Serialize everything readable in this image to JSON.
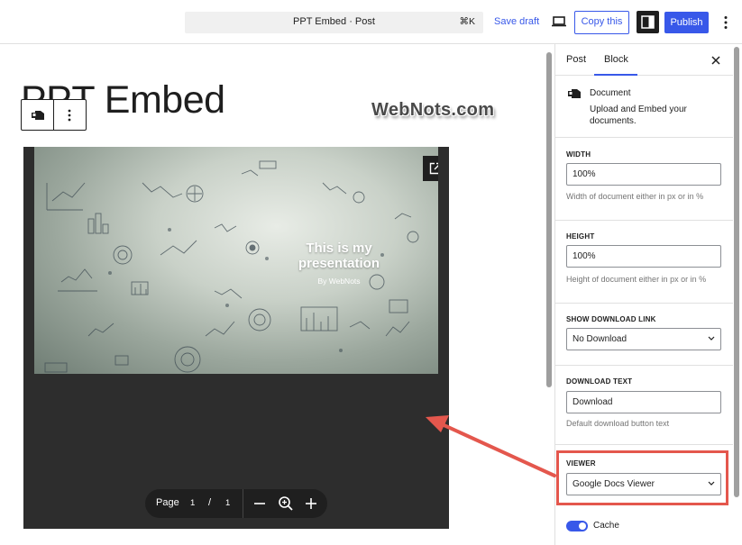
{
  "topbar": {
    "command_title": "PPT Embed · Post",
    "shortcut": "⌘K",
    "save_draft": "Save draft",
    "copy_label": "Copy this",
    "publish_label": "Publish"
  },
  "editor": {
    "post_title": "PPT Embed",
    "watermark": "WebNots.com"
  },
  "slide": {
    "title": "This is my presentation",
    "subtitle": "By WebNots"
  },
  "pager": {
    "label": "Page",
    "current": "1",
    "separator": "/",
    "total": "1"
  },
  "sidebar": {
    "tabs": [
      {
        "label": "Post"
      },
      {
        "label": "Block"
      }
    ],
    "block_name": "Document",
    "block_desc": "Upload and Embed your documents.",
    "width": {
      "label": "WIDTH",
      "value": "100%",
      "help": "Width of document either in px or in %"
    },
    "height": {
      "label": "HEIGHT",
      "value": "100%",
      "help": "Height of document either in px or in %"
    },
    "download_link": {
      "label": "SHOW DOWNLOAD LINK",
      "value": "No Download"
    },
    "download_text": {
      "label": "DOWNLOAD TEXT",
      "value": "Download",
      "help": "Default download button text"
    },
    "viewer": {
      "label": "VIEWER",
      "value": "Google Docs Viewer"
    },
    "cache": {
      "label": "Cache",
      "enabled": true
    }
  },
  "colors": {
    "accent": "#3858e9",
    "annotation": "#e4574d",
    "viewer_bg": "#2d2d2d"
  }
}
